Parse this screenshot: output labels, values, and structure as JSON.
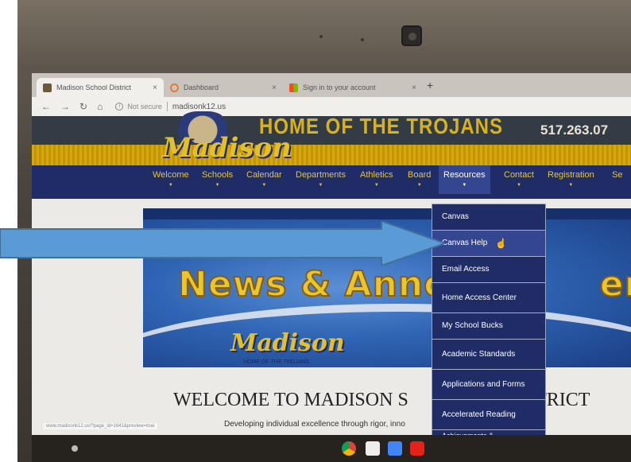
{
  "browser": {
    "tabs": [
      {
        "label": "Madison School District",
        "active": true
      },
      {
        "label": "Dashboard",
        "active": false
      },
      {
        "label": "Sign in to your account",
        "active": false
      }
    ],
    "new_tab": "+",
    "security": "Not secure",
    "url": "madisonk12.us"
  },
  "site": {
    "banner_title": "HOME OF THE TROJANS",
    "phone": "517.263.07",
    "logo": "Madison",
    "nav": [
      "Welcome",
      "Schools",
      "Calendar",
      "Departments",
      "Athletics",
      "Board",
      "Resources",
      "Contact",
      "Registration",
      "Se"
    ],
    "active_nav": "Resources"
  },
  "dropdown": {
    "items": [
      "Canvas",
      "Canvas Help",
      "Email Access",
      "Home Access Center",
      "My School Bucks",
      "Academic Standards",
      "Applications and Forms",
      "Accelerated Reading",
      "Achievements &"
    ],
    "hovered": "Canvas Help"
  },
  "hero": {
    "title": "News & Annou",
    "title_right": "ents",
    "logo": "Madison",
    "tagline": "HOME OF THE TROJANS"
  },
  "page": {
    "welcome_left": "WELCOME TO MADISON S",
    "welcome_right": "ISTRICT",
    "tagline_left": "Developing individual excellence through rigor, inno",
    "tagline_right": "ention",
    "status_url": "www.madisonk12.us/?page_id=1641&preview=true"
  },
  "colors": {
    "navy": "#1f2c66",
    "gold": "#e7c43b",
    "arrow": "#5b9bd5"
  }
}
